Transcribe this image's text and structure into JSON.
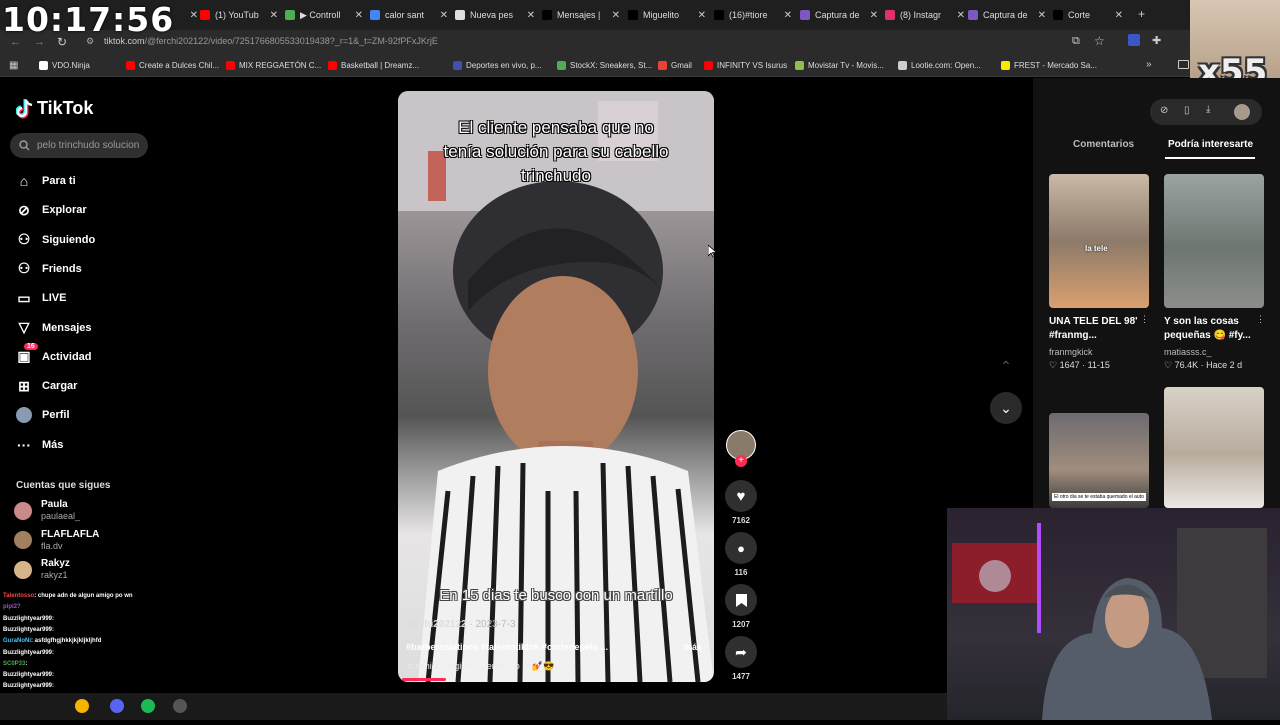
{
  "overlay": {
    "clock": "10:17:56",
    "multiplier": "x55"
  },
  "browser": {
    "tabs": [
      {
        "label": "",
        "color": "#1f1f1f"
      },
      {
        "label": "(1) YouTub",
        "color": "#ff0000"
      },
      {
        "label": "▶ Controll",
        "color": "#4caf50"
      },
      {
        "label": "calor sant",
        "color": "#4285f4"
      },
      {
        "label": "Nueva pes",
        "color": "#e0e0e0"
      },
      {
        "label": "Mensajes |",
        "color": "#000000"
      },
      {
        "label": "Miguelito",
        "color": "#000000"
      },
      {
        "label": "(16)#tiore",
        "color": "#000000"
      },
      {
        "label": "Captura de",
        "color": "#7e57c2"
      },
      {
        "label": "(8) Instagr",
        "color": "#e1306c"
      },
      {
        "label": "Captura de",
        "color": "#7e57c2"
      },
      {
        "label": "Corte",
        "color": "#000000"
      }
    ],
    "url_main": "tiktok.com",
    "url_rest": "/@ferchi202122/video/7251766805533019438?_r=1&_t=ZM-92fPFxJKrjE",
    "bookmarks": [
      {
        "label": "VDO.Ninja",
        "color": "#ffffff"
      },
      {
        "label": "Create a Dulces Chil...",
        "color": "#ff0000"
      },
      {
        "label": "MIX REGGAETÓN C...",
        "color": "#ff0000"
      },
      {
        "label": "Basketball | Dreamz...",
        "color": "#ff0000"
      },
      {
        "label": "Deportes en vivo, p...",
        "color": "#3f51b5"
      },
      {
        "label": "StockX: Sneakers, St...",
        "color": "#4caf50"
      },
      {
        "label": "Gmail",
        "color": "#ea4335"
      },
      {
        "label": "INFINITY VS Isurus",
        "color": "#ff0000"
      },
      {
        "label": "Movistar Tv - Movis...",
        "color": "#8bc34a"
      },
      {
        "label": "Lootie.com: Open...",
        "color": "#cccccc"
      },
      {
        "label": "FREST - Mercado Sa...",
        "color": "#ffe600"
      }
    ]
  },
  "tiktok": {
    "logo": "TikTok",
    "search_placeholder": "pelo trinchudo solucion",
    "nav": [
      {
        "label": "Para ti",
        "icon": "home-icon"
      },
      {
        "label": "Explorar",
        "icon": "compass-icon"
      },
      {
        "label": "Siguiendo",
        "icon": "following-icon"
      },
      {
        "label": "Friends",
        "icon": "friends-icon"
      },
      {
        "label": "LIVE",
        "icon": "live-icon"
      },
      {
        "label": "Mensajes",
        "icon": "messages-icon"
      },
      {
        "label": "Actividad",
        "icon": "activity-icon",
        "badge": "16"
      },
      {
        "label": "Cargar",
        "icon": "upload-icon"
      },
      {
        "label": "Perfil",
        "icon": "profile-icon"
      },
      {
        "label": "Más",
        "icon": "more-icon"
      }
    ],
    "following_header": "Cuentas que sigues",
    "following": [
      {
        "name": "Paula",
        "user": "paulaeal_",
        "color": "#c98a8a"
      },
      {
        "name": "FLAFLAFLA",
        "user": "fla.dv",
        "color": "#a08060"
      },
      {
        "name": "Rakyz",
        "user": "rakyz1",
        "color": "#d8b48a"
      }
    ],
    "video": {
      "caption": "El cliente pensaba que no tenía solución para su cabello trinchudo",
      "subtitle": "En 15 dias te busco con un martillo",
      "author": "ferchi202122",
      "date": "· 2023-7-3",
      "tags": "#barberoslatinos #talentotiktok #cortedepelo ...",
      "more": "más",
      "sound": "♫ sonido original - Fernando us💅😎"
    },
    "actions": {
      "likes": "7162",
      "comments": "116",
      "saves": "1207",
      "shares": "1477"
    },
    "right": {
      "tabs": [
        "Comentarios",
        "Podría interesarte"
      ],
      "cards": [
        {
          "title": "UNA TELE DEL 98' #franmg...",
          "user": "franmgkick",
          "stat": "♡ 1647 · 11-15"
        },
        {
          "title": "Y son las cosas pequeñas 😋 #fy...",
          "user": "matiasss.c_",
          "stat": "♡ 76.4K · Hace 2 d"
        }
      ],
      "thumb_texts": [
        "la tele",
        "El otro dia se te estaba quemado el auto"
      ]
    }
  },
  "chat": [
    {
      "user": "Talentosso",
      "msg": ": chupe adn de algun amigo po wn",
      "color": "#ff4444"
    },
    {
      "user": "pipi2?",
      "msg": "",
      "color": "#9b59b6"
    },
    {
      "user": "Buzzlightyear999",
      "msg": ":",
      "color": "#ffffff"
    },
    {
      "user": "Buzzlightyear999",
      "msg": ":",
      "color": "#ffffff"
    },
    {
      "user": "GuraNoNi",
      "msg": ": asfdgfhgjhkkjkjkljkljhfd",
      "color": "#4fc3f7"
    },
    {
      "user": "Buzzlightyear999",
      "msg": ":",
      "color": "#ffffff"
    },
    {
      "user": "SC0P33",
      "msg": ":",
      "color": "#4caf50"
    },
    {
      "user": "Buzzlightyear999",
      "msg": ":",
      "color": "#ffffff"
    },
    {
      "user": "Buzzlightyear999",
      "msg": ":",
      "color": "#ffffff"
    },
    {
      "user": "SC0P33",
      "msg": ":",
      "color": "#4caf50"
    },
    {
      "user": "Buzzlightyear999",
      "msg": ":",
      "color": "#ffffff"
    }
  ]
}
